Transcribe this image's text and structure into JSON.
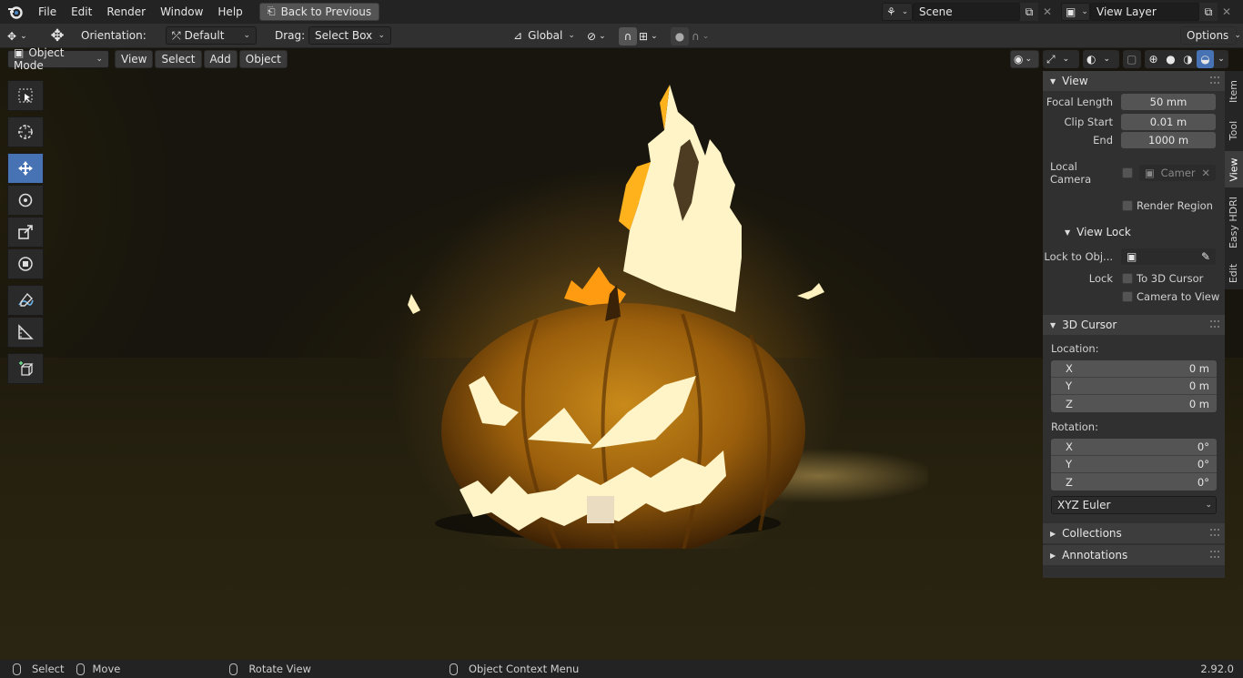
{
  "topbar": {
    "menus": [
      "File",
      "Edit",
      "Render",
      "Window",
      "Help"
    ],
    "back_button": "Back to Previous",
    "scene_name": "Scene",
    "view_layer_name": "View Layer"
  },
  "tool_header": {
    "orientation_label": "Orientation:",
    "orientation_value": "Default",
    "drag_label": "Drag:",
    "drag_value": "Select Box",
    "transform_orientation": "Global",
    "options_label": "Options"
  },
  "viewport_header": {
    "mode": "Object Mode",
    "menus": [
      "View",
      "Select",
      "Add",
      "Object"
    ]
  },
  "toolbar": {
    "tools": [
      "select-box-tool",
      "cursor-tool",
      "move-tool",
      "rotate-tool",
      "scale-tool",
      "transform-tool",
      "annotate-tool",
      "measure-tool",
      "add-cube-tool"
    ],
    "active_tool": "move-tool"
  },
  "sidebar": {
    "tabs": [
      "Item",
      "Tool",
      "View",
      "Easy HDRI",
      "Edit"
    ],
    "active_tab": "View",
    "view_panel": {
      "title": "View",
      "focal_length_label": "Focal Length",
      "focal_length": "50 mm",
      "clip_start_label": "Clip Start",
      "clip_start": "0.01 m",
      "end_label": "End",
      "end": "1000 m",
      "local_camera_label": "Local Camera",
      "local_camera_value": "Camer",
      "render_region_label": "Render Region"
    },
    "view_lock": {
      "title": "View Lock",
      "lock_to_object_label": "Lock to Obj...",
      "lock_label": "Lock",
      "to_3d_cursor_label": "To 3D Cursor",
      "camera_to_view_label": "Camera to View"
    },
    "cursor_panel": {
      "title": "3D Cursor",
      "location_label": "Location:",
      "location": [
        {
          "axis": "X",
          "value": "0 m"
        },
        {
          "axis": "Y",
          "value": "0 m"
        },
        {
          "axis": "Z",
          "value": "0 m"
        }
      ],
      "rotation_label": "Rotation:",
      "rotation": [
        {
          "axis": "X",
          "value": "0°"
        },
        {
          "axis": "Y",
          "value": "0°"
        },
        {
          "axis": "Z",
          "value": "0°"
        }
      ],
      "rotation_mode": "XYZ Euler"
    },
    "collapsed_panels": [
      "Collections",
      "Annotations"
    ]
  },
  "statusbar": {
    "select": "Select",
    "move": "Move",
    "rotate_view": "Rotate View",
    "context_menu": "Object Context Menu",
    "version": "2.92.0"
  },
  "colors": {
    "accent": "#4772b3",
    "background": "#1d1d1d",
    "panel": "#303030"
  }
}
